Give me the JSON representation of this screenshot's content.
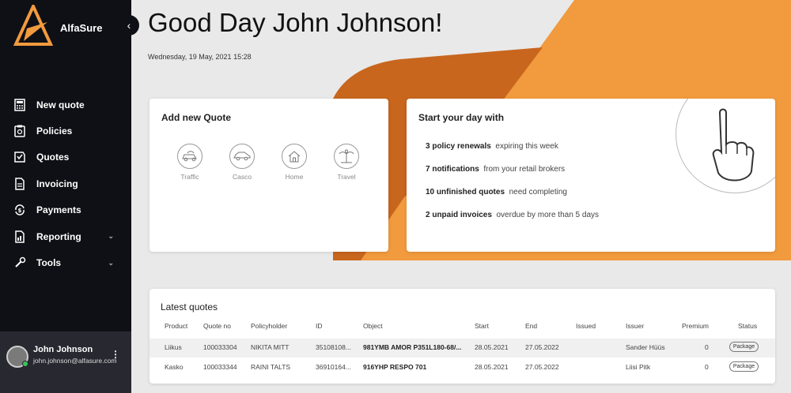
{
  "brand": {
    "name": "AlfaSure",
    "accent": "#f19a3e"
  },
  "sidebar": {
    "collapse_icon": "chevron-left-icon",
    "items": [
      {
        "label": "New quote",
        "icon": "calculator-icon"
      },
      {
        "label": "Policies",
        "icon": "policy-document-icon"
      },
      {
        "label": "Quotes",
        "icon": "quotes-icon"
      },
      {
        "label": "Invoicing",
        "icon": "invoice-icon"
      },
      {
        "label": "Payments",
        "icon": "payments-icon"
      },
      {
        "label": "Reporting",
        "icon": "report-icon",
        "chevron": "⌄"
      },
      {
        "label": "Tools",
        "icon": "tools-icon",
        "chevron": "⌄"
      }
    ]
  },
  "user": {
    "name": "John Johnson",
    "email": "john.johnson@alfasure.com",
    "menu": "⋮"
  },
  "header": {
    "greeting": "Good Day John Johnson!",
    "date": "Wednesday, 19 May, 2021 15:28"
  },
  "add_quote": {
    "title": "Add new Quote",
    "types": [
      {
        "label": "Traffic",
        "icon": "traffic-car-icon"
      },
      {
        "label": "Casco",
        "icon": "car-icon"
      },
      {
        "label": "Home",
        "icon": "home-icon"
      },
      {
        "label": "Travel",
        "icon": "palm-tree-icon"
      }
    ]
  },
  "start_day": {
    "title": "Start your day with",
    "rows": [
      {
        "bold": "3 policy renewals",
        "rest": "expiring this week"
      },
      {
        "bold": "7 notifications",
        "rest": "from your retail brokers"
      },
      {
        "bold": "10 unfinished quotes",
        "rest": "need completing"
      },
      {
        "bold": "2 unpaid invoices",
        "rest": "overdue by more than 5 days"
      }
    ]
  },
  "latest_quotes": {
    "title": "Latest quotes",
    "columns": [
      "Product",
      "Quote no",
      "Policyholder",
      "ID",
      "Object",
      "Start",
      "End",
      "Issued",
      "Issuer",
      "Premium",
      "Status"
    ],
    "rows": [
      {
        "product": "Liikus",
        "quote_no": "100033304",
        "policyholder": "NIKITA MITT",
        "id": "35108108...",
        "object": "981YMB AMOR P351L180-68/...",
        "start": "28.05.2021",
        "end": "27.05.2022",
        "issued": "",
        "issuer": "Sander Hüüs",
        "premium": "0",
        "status": "Package"
      },
      {
        "product": "Kasko",
        "quote_no": "100033344",
        "policyholder": "RAINI TALTS",
        "id": "36910164...",
        "object": "916YHP RESPO 701",
        "start": "28.05.2021",
        "end": "27.05.2022",
        "issued": "",
        "issuer": "Liisi Pitk",
        "premium": "0",
        "status": "Package"
      }
    ]
  }
}
